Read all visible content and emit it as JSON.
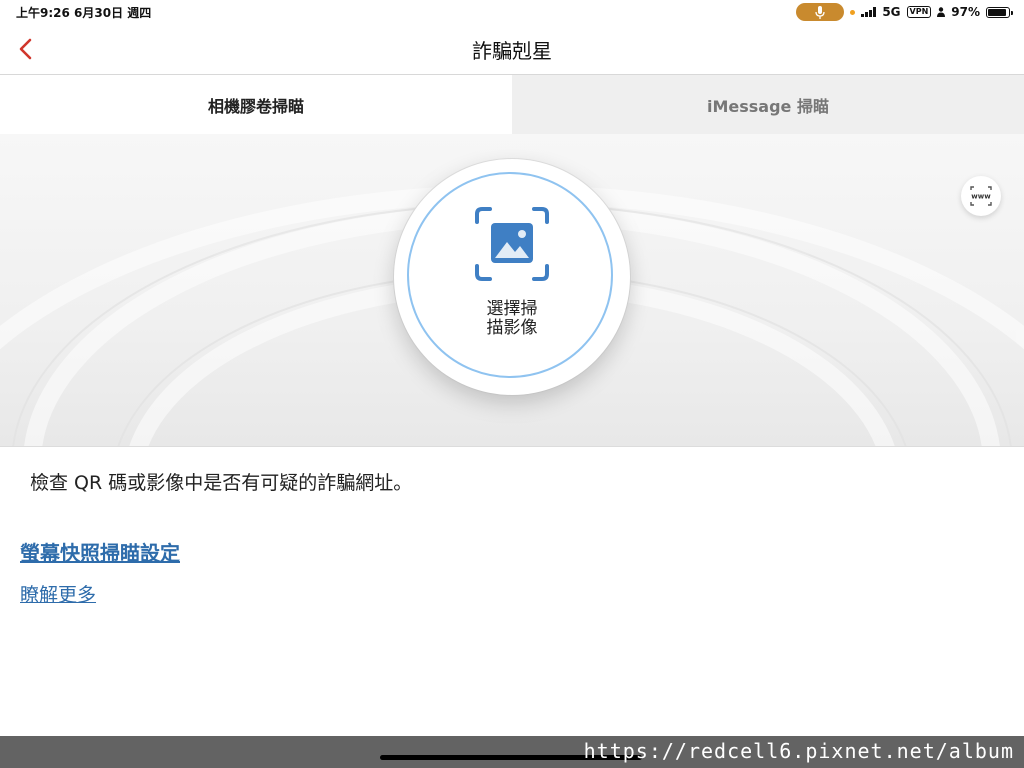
{
  "status_bar": {
    "time_date": "上午9:26   6月30日 週四",
    "network": "5G",
    "vpn": "VPN",
    "battery": "97%",
    "battery_level": 0.97
  },
  "nav": {
    "title": "詐騙剋星",
    "back_icon": "chevron-left-icon",
    "accent": "#d0362c"
  },
  "tabs": [
    {
      "label": "相機膠卷掃瞄",
      "active": true
    },
    {
      "label": "iMessage 掃瞄",
      "active": false
    }
  ],
  "scan": {
    "icon": "image-scan-icon",
    "label_line1": "選擇掃",
    "label_line2": "描影像",
    "ring_color": "#8fc3f0",
    "icon_color": "#3f7fc4"
  },
  "url_scan_button": {
    "icon": "www-scan-icon",
    "text": "www"
  },
  "description": "檢查 QR 碼或影像中是否有可疑的詐騙網址。",
  "links": {
    "screenshot_settings": "螢幕快照掃瞄設定",
    "learn_more": "瞭解更多",
    "color": "#2e6cab"
  },
  "watermark": "https://redcell6.pixnet.net/album"
}
